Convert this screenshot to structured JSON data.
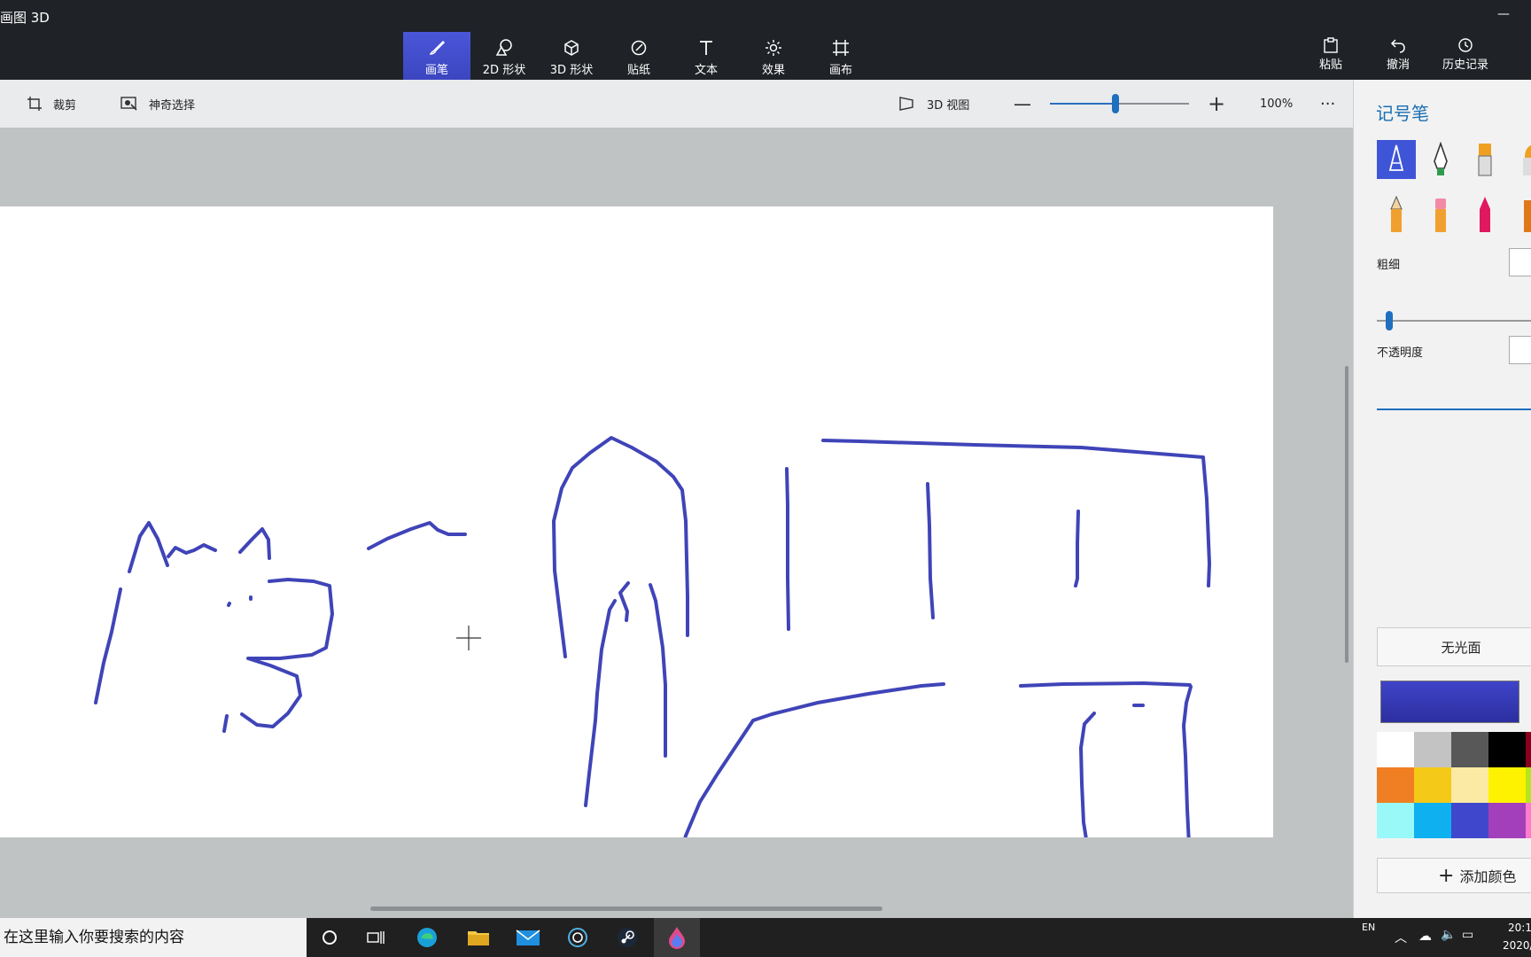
{
  "window": {
    "title": "画图 3D"
  },
  "ribbon": {
    "tools": [
      {
        "label": "画笔",
        "icon": "brush-icon"
      },
      {
        "label": "2D 形状",
        "icon": "2d-shapes-icon"
      },
      {
        "label": "3D 形状",
        "icon": "3d-shapes-icon"
      },
      {
        "label": "贴纸",
        "icon": "stickers-icon"
      },
      {
        "label": "文本",
        "icon": "text-icon"
      },
      {
        "label": "效果",
        "icon": "effects-icon"
      },
      {
        "label": "画布",
        "icon": "canvas-icon"
      }
    ],
    "right": [
      {
        "label": "粘贴",
        "icon": "paste-icon"
      },
      {
        "label": "撤消",
        "icon": "undo-icon"
      },
      {
        "label": "历史记录",
        "icon": "history-icon"
      }
    ]
  },
  "subbar": {
    "crop": "裁剪",
    "magic_select": "神奇选择",
    "view3d": "3D 视图",
    "zoom_percent": "100%",
    "zoom_level": 0.47
  },
  "panel": {
    "title": "记号笔",
    "thickness_label": "粗细",
    "opacity_label": "不透明度",
    "finish": "无光面",
    "add_color": "添加颜色",
    "current_color": "#3f44c8",
    "palette": [
      [
        "#ffffff",
        "#c3c3c3",
        "#585858",
        "#000000",
        "#88001b"
      ],
      [
        "#f07f24",
        "#f5c918",
        "#faeaa4",
        "#fff200",
        "#b5e61d"
      ],
      [
        "#99f8f8",
        "#0fb0ef",
        "#3f48cc",
        "#a33fba",
        "#ff7ccb"
      ]
    ],
    "brushes": [
      "marker-icon",
      "calligraphy-pen-icon",
      "oil-brush-icon",
      "watercolor-icon",
      "pencil-icon",
      "eraser-icon",
      "crayon-icon",
      "spray-can-icon"
    ]
  },
  "taskbar": {
    "search_placeholder": "在这里输入你要搜索的内容",
    "lang": "EN",
    "time": "20:1",
    "date": "2020/"
  },
  "stroke_color": "#3f44b8"
}
